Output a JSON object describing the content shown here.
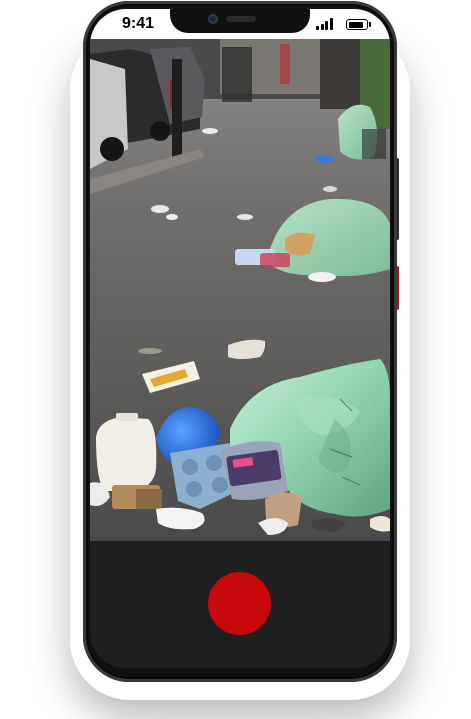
{
  "status_bar": {
    "time": "9:41",
    "icons": [
      "signal-icon",
      "battery-icon"
    ]
  },
  "camera": {
    "viewfinder_scene": "street-litter-photo",
    "record_button_color": "#c8080b",
    "controls_background": "#1f1f1f"
  },
  "device": {
    "frame_color": "#111111"
  }
}
